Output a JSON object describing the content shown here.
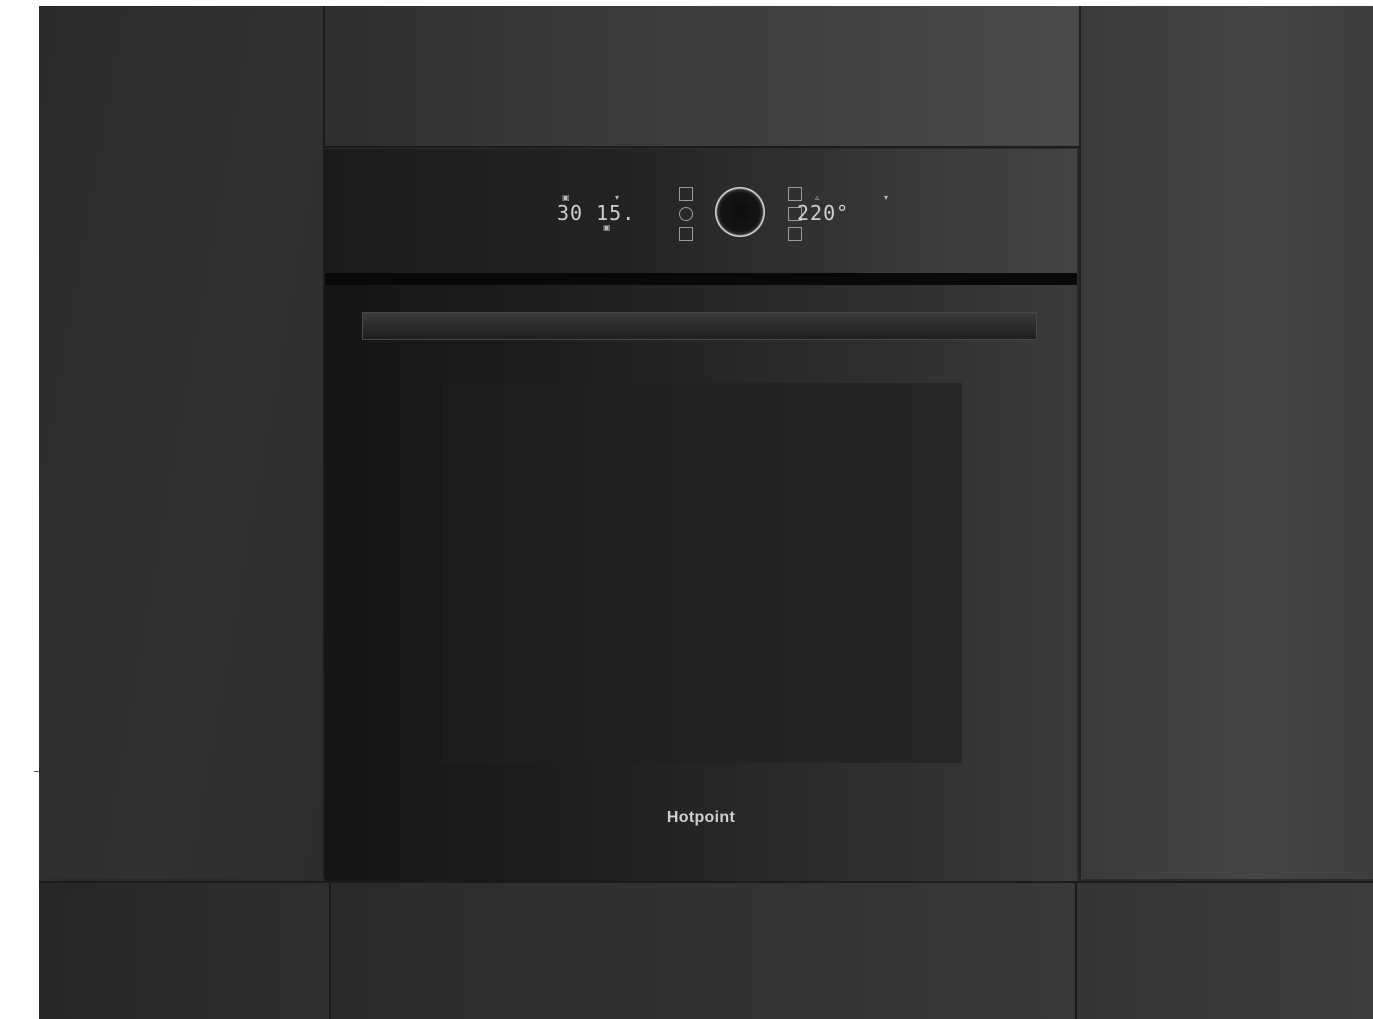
{
  "oven": {
    "brand": "Hotpoint",
    "timer_display": "30 15.",
    "temperature_display": "220°"
  },
  "colors": {
    "cabinet": "#2e2e2e",
    "oven_body": "#151515",
    "display_text": "#cfcfcf"
  },
  "icons": {
    "knob": "control-knob-icon",
    "left_column": [
      "grill-icon",
      "clock-icon",
      "fan-icon"
    ],
    "right_column": [
      "menu-icon",
      "play-icon",
      "settings-icon"
    ]
  }
}
